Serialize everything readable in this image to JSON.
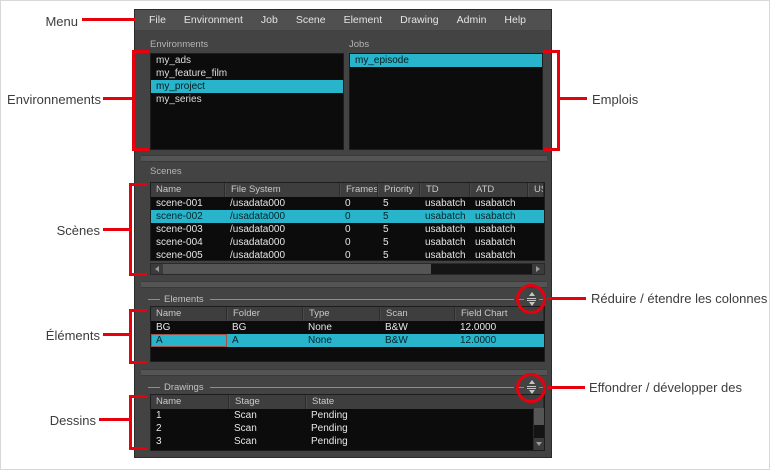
{
  "colors": {
    "selection": "#28b4ca",
    "annotation_red": "#e8000d"
  },
  "menu_bar": {
    "items": [
      {
        "label": "File"
      },
      {
        "label": "Environment"
      },
      {
        "label": "Job"
      },
      {
        "label": "Scene"
      },
      {
        "label": "Element"
      },
      {
        "label": "Drawing"
      },
      {
        "label": "Admin"
      },
      {
        "label": "Help"
      }
    ]
  },
  "environments_panel": {
    "label": "Environments",
    "items": [
      {
        "label": "my_ads",
        "selected": false
      },
      {
        "label": "my_feature_film",
        "selected": false
      },
      {
        "label": "my_project",
        "selected": true
      },
      {
        "label": "my_series",
        "selected": false
      }
    ]
  },
  "jobs_panel": {
    "label": "Jobs",
    "items": [
      {
        "label": "my_episode",
        "selected": true
      }
    ]
  },
  "scenes_panel": {
    "label": "Scenes",
    "columns": [
      "Name",
      "File System",
      "Frames",
      "Priority",
      "TD",
      "ATD",
      "USE"
    ],
    "rows": [
      [
        "scene-001",
        "/usadata000",
        "0",
        "5",
        "usabatch",
        "usabatch",
        ""
      ],
      [
        "scene-002",
        "/usadata000",
        "0",
        "5",
        "usabatch",
        "usabatch",
        ""
      ],
      [
        "scene-003",
        "/usadata000",
        "0",
        "5",
        "usabatch",
        "usabatch",
        ""
      ],
      [
        "scene-004",
        "/usadata000",
        "0",
        "5",
        "usabatch",
        "usabatch",
        ""
      ],
      [
        "scene-005",
        "/usadata000",
        "0",
        "5",
        "usabatch",
        "usabatch",
        ""
      ]
    ],
    "selected_row": 1
  },
  "elements_panel": {
    "label": "Elements",
    "columns": [
      "Name",
      "Folder",
      "Type",
      "Scan",
      "Field Chart"
    ],
    "rows": [
      [
        "BG",
        "BG",
        "None",
        "B&W",
        "12.0000"
      ],
      [
        "A",
        "A",
        "None",
        "B&W",
        "12.0000"
      ]
    ],
    "selected_row": 1,
    "focus_cell": [
      1,
      0
    ]
  },
  "drawings_panel": {
    "label": "Drawings",
    "columns": [
      "Name",
      "Stage",
      "State"
    ],
    "rows": [
      [
        "1",
        "Scan",
        "Pending"
      ],
      [
        "2",
        "Scan",
        "Pending"
      ],
      [
        "3",
        "Scan",
        "Pending"
      ]
    ],
    "selected_row": -1
  },
  "annotations": {
    "menu": "Menu",
    "environments": "Environnements",
    "jobs": "Emplois",
    "scenes": "Scènes",
    "elements": "Éléments",
    "drawings": "Dessins",
    "collapse_columns": "Réduire / étendre les colonnes",
    "collapse_rows": "Effondrer / développer des"
  }
}
